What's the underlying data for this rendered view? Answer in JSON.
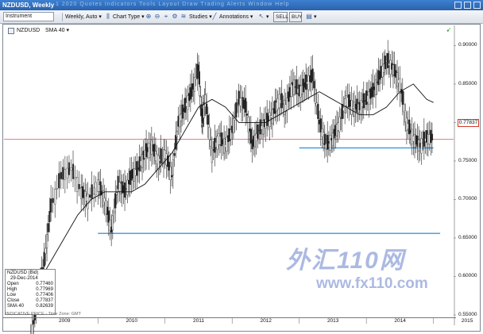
{
  "window": {
    "title": "NZDUSD, Weekly",
    "faint_toolbar_text": "1 2020  Quotes  Indicators  Tools  Layout  Draw  Trading  Alerts  Window  Help"
  },
  "toolbar": {
    "instrument_label": "Instrument",
    "period": "Weekly",
    "scale": "Auto",
    "chart_type": "Chart Type",
    "studies": "Studies",
    "annotations": "Annotations",
    "sell": "SELL",
    "buy": "BUY"
  },
  "chart_header": {
    "symbol": "NZDUSD",
    "study": "SMA 40"
  },
  "price_axis": {
    "ticks": [
      "0.90000",
      "0.85000",
      "0.80000",
      "0.75000",
      "0.70000",
      "0.65000",
      "0.60000",
      "0.55000"
    ],
    "current_price": "0.77837"
  },
  "time_axis": {
    "labels": [
      "2009",
      "2010",
      "2011",
      "2012",
      "2013",
      "2014",
      "2015"
    ]
  },
  "infobox": {
    "title": "NZDUSD (Bid)",
    "date": "29-Dec-2014",
    "rows": [
      {
        "k": "Open",
        "v": "0.77460"
      },
      {
        "k": "High",
        "v": "0.77969"
      },
      {
        "k": "Low",
        "v": "0.77406"
      },
      {
        "k": "Close",
        "v": "0.77837"
      },
      {
        "k": "SMA 40",
        "v": "0.82639"
      }
    ]
  },
  "footer_note": "INDICATIVE PRICE - Time Zone: GMT",
  "watermark": {
    "line1": "外汇110网",
    "line2": "www.fx110.com"
  },
  "colors": {
    "sma": "#111111",
    "support": "#3f96d8",
    "price_line": "#d03b2b",
    "title_bar": "#2f6cbd"
  },
  "chart_data": {
    "type": "line",
    "title": "NZDUSD, Weekly",
    "xlabel": "",
    "ylabel": "",
    "ylim": [
      0.55,
      0.92
    ],
    "x_range": [
      "2009",
      "2015"
    ],
    "series": [
      {
        "name": "NZDUSD",
        "x": [
          2009.0,
          2009.1,
          2009.2,
          2009.3,
          2009.45,
          2009.6,
          2009.75,
          2009.85,
          2010.0,
          2010.1,
          2010.2,
          2010.3,
          2010.4,
          2010.5,
          2010.6,
          2010.7,
          2010.8,
          2010.9,
          2011.0,
          2011.1,
          2011.2,
          2011.3,
          2011.4,
          2011.5,
          2011.55,
          2011.6,
          2011.7,
          2011.8,
          2011.9,
          2012.0,
          2012.1,
          2012.2,
          2012.3,
          2012.4,
          2012.5,
          2012.6,
          2012.7,
          2012.8,
          2012.9,
          2013.0,
          2013.1,
          2013.2,
          2013.3,
          2013.4,
          2013.5,
          2013.6,
          2013.7,
          2013.8,
          2013.9,
          2014.0,
          2014.1,
          2014.2,
          2014.3,
          2014.4,
          2014.5,
          2014.6,
          2014.7,
          2014.8,
          2014.9,
          2015.0
        ],
        "values": [
          0.52,
          0.57,
          0.62,
          0.69,
          0.73,
          0.74,
          0.71,
          0.7,
          0.72,
          0.7,
          0.66,
          0.72,
          0.71,
          0.73,
          0.74,
          0.76,
          0.77,
          0.75,
          0.76,
          0.73,
          0.8,
          0.82,
          0.84,
          0.87,
          0.8,
          0.83,
          0.76,
          0.78,
          0.77,
          0.79,
          0.83,
          0.82,
          0.77,
          0.79,
          0.8,
          0.81,
          0.83,
          0.82,
          0.85,
          0.84,
          0.85,
          0.86,
          0.8,
          0.77,
          0.78,
          0.8,
          0.83,
          0.82,
          0.82,
          0.83,
          0.84,
          0.86,
          0.88,
          0.87,
          0.85,
          0.8,
          0.78,
          0.77,
          0.78,
          0.78
        ]
      },
      {
        "name": "SMA 40",
        "x": [
          2009.1,
          2009.3,
          2009.5,
          2009.7,
          2009.9,
          2010.1,
          2010.3,
          2010.5,
          2010.7,
          2010.9,
          2011.1,
          2011.3,
          2011.5,
          2011.7,
          2011.9,
          2012.1,
          2012.3,
          2012.5,
          2012.7,
          2012.9,
          2013.1,
          2013.3,
          2013.5,
          2013.7,
          2013.9,
          2014.1,
          2014.3,
          2014.5,
          2014.7,
          2014.9,
          2015.0
        ],
        "values": [
          0.59,
          0.62,
          0.65,
          0.68,
          0.7,
          0.71,
          0.71,
          0.71,
          0.72,
          0.74,
          0.76,
          0.79,
          0.82,
          0.83,
          0.82,
          0.8,
          0.8,
          0.8,
          0.81,
          0.82,
          0.83,
          0.84,
          0.83,
          0.82,
          0.81,
          0.81,
          0.82,
          0.84,
          0.85,
          0.83,
          0.826
        ]
      }
    ],
    "support_lines": [
      {
        "value": 0.767,
        "from": 2013.0,
        "to": 2015.0
      },
      {
        "value": 0.656,
        "from": 2010.0,
        "to": 2015.1
      }
    ],
    "current_price_line": 0.77837,
    "grid": false,
    "legend": "top-left"
  }
}
